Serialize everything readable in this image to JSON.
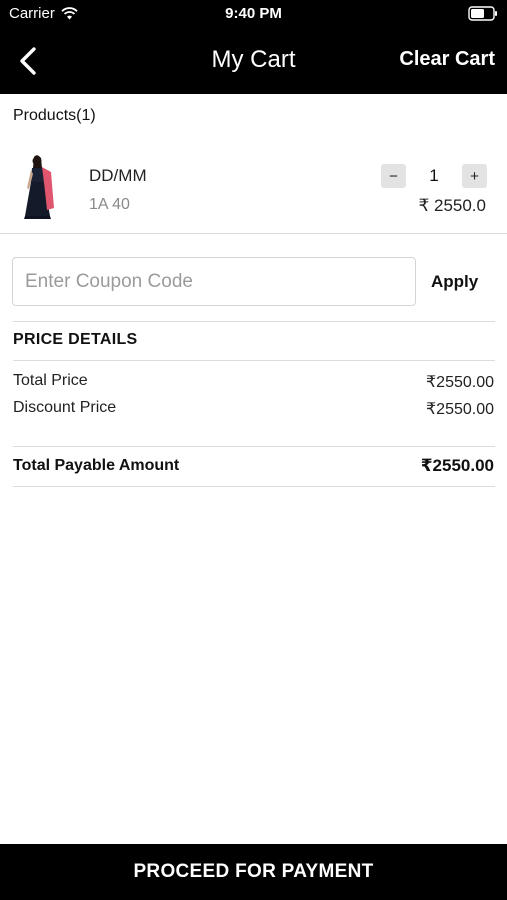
{
  "status_bar": {
    "carrier": "Carrier",
    "time": "9:40 PM",
    "icons": [
      "wifi-icon",
      "battery-icon"
    ]
  },
  "nav": {
    "back_icon": "chevron-left-icon",
    "title": "My Cart",
    "clear_label": "Clear Cart"
  },
  "products": {
    "header": "Products(1)",
    "items": [
      {
        "name": "DD/MM",
        "size": "1A 40",
        "quantity": "1",
        "minus": "−",
        "plus": "+",
        "price": "₹ 2550.0",
        "thumbnail": "dress-thumbnail"
      }
    ]
  },
  "coupon": {
    "placeholder": "Enter Coupon Code",
    "value": "",
    "apply_label": "Apply"
  },
  "price_details": {
    "heading": "PRICE DETAILS",
    "rows": [
      {
        "label": "Total Price",
        "value": "₹2550.00"
      },
      {
        "label": "Discount Price",
        "value": "₹2550.00"
      }
    ],
    "total_label": "Total Payable Amount",
    "total_value": "₹2550.00"
  },
  "footer": {
    "proceed_label": "PROCEED FOR PAYMENT"
  },
  "colors": {
    "bar_background": "#000000",
    "stepper_background": "#e3e3e3",
    "divider": "#dcdcdc",
    "muted_text": "#8a8a8a"
  }
}
